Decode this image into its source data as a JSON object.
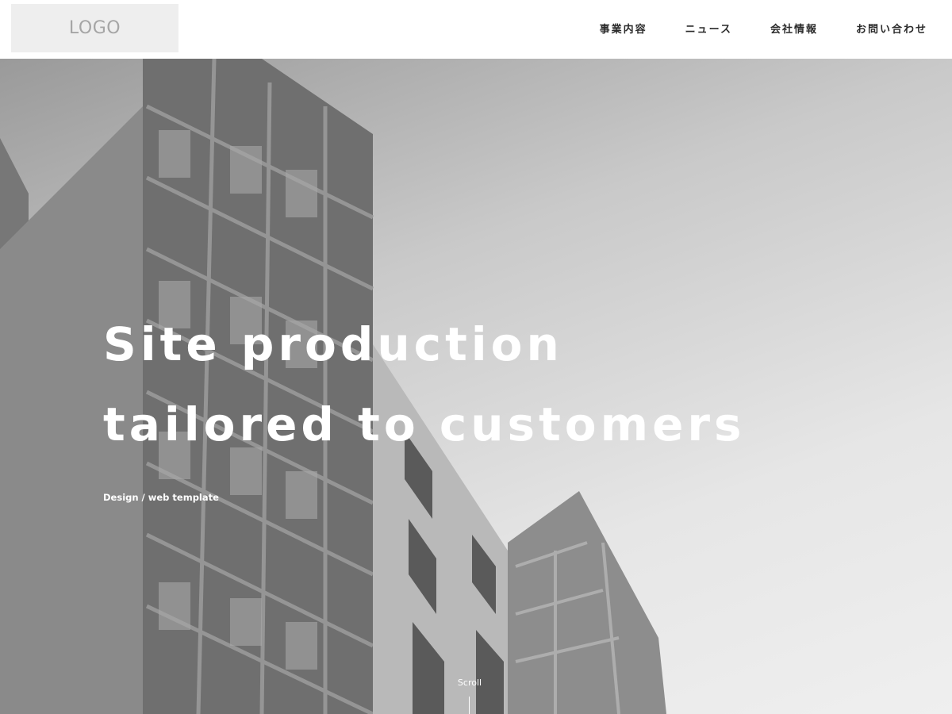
{
  "header": {
    "logo_text": "LOGO",
    "nav": [
      {
        "label": "事業内容"
      },
      {
        "label": "ニュース"
      },
      {
        "label": "会社情報"
      },
      {
        "label": "お問い合わせ"
      }
    ]
  },
  "hero": {
    "headline_line1": "Site production",
    "headline_line2": "tailored to customers",
    "subline": "Design / web template",
    "scroll_label": "Scroll"
  },
  "colors": {
    "header_bg": "#ffffff",
    "logo_bg": "#eeeeee",
    "nav_text": "#2b2b2b",
    "hero_text": "#ffffff"
  }
}
